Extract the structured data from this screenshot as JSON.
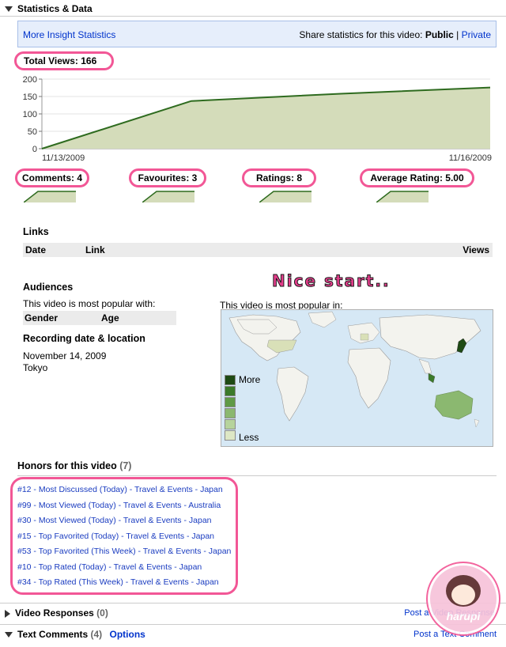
{
  "section_stats": {
    "title": "Statistics & Data"
  },
  "insight_bar": {
    "more_link": "More Insight Statistics",
    "share_label": "Share statistics for this video:",
    "public": "Public",
    "sep": "|",
    "private": "Private"
  },
  "total_views": "Total Views: 166",
  "chart_data": {
    "type": "area",
    "x": [
      "11/13/2009",
      "11/14/2009",
      "11/15/2009",
      "11/16/2009"
    ],
    "values": [
      0,
      137,
      158,
      176
    ],
    "x_tick_labels": [
      "11/13/2009",
      "11/16/2009"
    ],
    "y_ticks": [
      200,
      150,
      100,
      50,
      0
    ],
    "ylim": [
      0,
      200
    ],
    "colors": {
      "line": "#2e6b1f",
      "fill": "#d4dcba"
    }
  },
  "stat_pills": [
    {
      "label": "Comments: 4"
    },
    {
      "label": "Favourites: 3"
    },
    {
      "label": "Ratings: 8"
    },
    {
      "label": "Average Rating: 5.00"
    }
  ],
  "links": {
    "title": "Links",
    "col_date": "Date",
    "col_link": "Link",
    "col_views": "Views"
  },
  "annotation": "Nice start..",
  "audiences": {
    "title": "Audiences",
    "popular_with": "This video is most popular with:",
    "col_gender": "Gender",
    "col_age": "Age"
  },
  "recording": {
    "title": "Recording date & location",
    "date": "November 14, 2009",
    "location": "Tokyo"
  },
  "map": {
    "title": "This video is most popular in:",
    "legend_more": "More",
    "legend_less": "Less",
    "legend_colors": [
      "#1e4a14",
      "#3b7a2a",
      "#5f9a46",
      "#8bb870",
      "#b6d39c",
      "#dde7c5"
    ]
  },
  "honors": {
    "title": "Honors for this video",
    "count": "(7)",
    "items": [
      "#12 - Most Discussed (Today) - Travel & Events - Japan",
      "#99 - Most Viewed (Today) - Travel & Events - Australia",
      "#30 - Most Viewed (Today) - Travel & Events - Japan",
      "#15 - Top Favorited (Today) - Travel & Events - Japan",
      "#53 - Top Favorited (This Week) - Travel & Events - Japan",
      "#10 - Top Rated (Today) - Travel & Events - Japan",
      "#34 - Top Rated (This Week) - Travel & Events - Japan"
    ]
  },
  "video_responses": {
    "title": "Video Responses",
    "count": "(0)",
    "link": "Post a Video Response"
  },
  "text_comments": {
    "title": "Text Comments",
    "count": "(4)",
    "options": "Options",
    "link": "Post a Text Comment"
  },
  "watermark": "harupi"
}
